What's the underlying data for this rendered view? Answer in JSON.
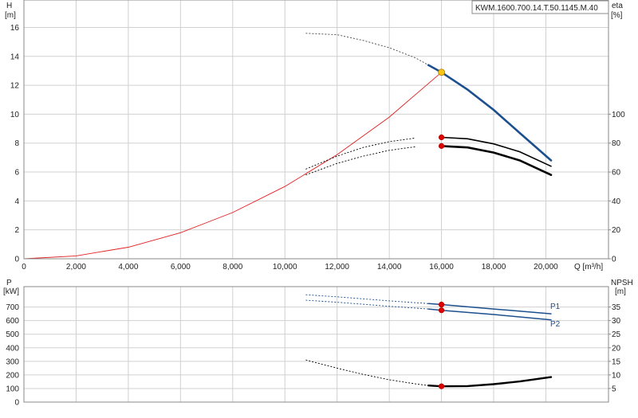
{
  "chart_data": [
    {
      "type": "line",
      "title": "KWM.1600.700.14.T.50.1145.M.40",
      "xlabel": "Q [m³/h]",
      "ylabel_left_name": "H",
      "ylabel_left_unit": "[m]",
      "ylabel_right_name": "eta",
      "ylabel_right_unit": "[%]",
      "x_ticks": [
        0,
        2000,
        4000,
        6000,
        8000,
        10000,
        12000,
        14000,
        16000,
        18000,
        20000
      ],
      "x_tick_labels": [
        "0",
        "2,000",
        "4,000",
        "6,000",
        "8,000",
        "10,000",
        "12,000",
        "14,000",
        "16,000",
        "18,000",
        "20,000"
      ],
      "xlim": [
        0,
        22400
      ],
      "y_left_ticks": [
        0,
        2,
        4,
        6,
        8,
        10,
        12,
        14,
        16
      ],
      "y_left_lim": [
        0,
        17.9
      ],
      "y_right_ticks": [
        0,
        20,
        40,
        60,
        80,
        100
      ],
      "y_right_lim": [
        0,
        179
      ],
      "grid": true,
      "duty_point": {
        "x": 16000,
        "y": 12.9
      },
      "series": [
        {
          "role": "pump-curve-H",
          "axis": "left",
          "color": "#1c4f8e",
          "x": [
            10800,
            12000,
            13000,
            14000,
            15000,
            15500,
            16000,
            17000,
            18000,
            19000,
            20200
          ],
          "y": [
            15.6,
            15.5,
            15.1,
            14.6,
            13.9,
            13.4,
            12.9,
            11.7,
            10.3,
            8.7,
            6.8
          ]
        },
        {
          "role": "system-curve",
          "axis": "left",
          "color": "#e02020",
          "x": [
            0,
            2000,
            4000,
            6000,
            8000,
            10000,
            12000,
            14000,
            16000
          ],
          "y": [
            0,
            0.2,
            0.8,
            1.8,
            3.2,
            5.0,
            7.2,
            9.8,
            12.9
          ]
        },
        {
          "role": "efficiency-1",
          "axis": "right",
          "color": "#000000",
          "x": [
            10800,
            12000,
            13000,
            14000,
            15000,
            16000,
            17000,
            18000,
            19000,
            20200
          ],
          "y": [
            62,
            71,
            77,
            81,
            83.5,
            84,
            83,
            79.5,
            74,
            64
          ]
        },
        {
          "role": "efficiency-2",
          "axis": "right",
          "color": "#000000",
          "x": [
            10800,
            12000,
            13000,
            14000,
            15000,
            16000,
            17000,
            18000,
            19000,
            20200
          ],
          "y": [
            58,
            66,
            71,
            75,
            77.5,
            78,
            77,
            73.5,
            68,
            58
          ]
        }
      ],
      "markers": [
        {
          "x": 16000,
          "y": 12.9,
          "axis": "left",
          "color": "#f5c518"
        },
        {
          "x": 16000,
          "y": 84,
          "axis": "right",
          "color": "#e00000"
        },
        {
          "x": 16000,
          "y": 78,
          "axis": "right",
          "color": "#e00000"
        }
      ]
    },
    {
      "type": "line",
      "ylabel_left_name": "P",
      "ylabel_left_unit": "[kW]",
      "ylabel_right_name": "NPSH",
      "ylabel_right_unit": "[m]",
      "x_ticks": [
        0,
        2000,
        4000,
        6000,
        8000,
        10000,
        12000,
        14000,
        16000,
        18000,
        20000
      ],
      "xlim": [
        0,
        22400
      ],
      "y_left_ticks": [
        0,
        100,
        200,
        300,
        400,
        500,
        600,
        700
      ],
      "y_left_lim": [
        0,
        850
      ],
      "y_right_ticks": [
        5,
        10,
        15,
        20,
        25,
        30,
        35
      ],
      "y_right_lim": [
        0,
        42.5
      ],
      "grid": true,
      "series": [
        {
          "name": "P1",
          "axis": "left",
          "color": "#1c4f8e",
          "x": [
            10800,
            12000,
            14000,
            15500,
            16000,
            18000,
            20200
          ],
          "y": [
            790,
            775,
            745,
            725,
            718,
            685,
            650
          ]
        },
        {
          "name": "P2",
          "axis": "left",
          "color": "#1c4f8e",
          "x": [
            10800,
            12000,
            14000,
            15500,
            16000,
            18000,
            20200
          ],
          "y": [
            750,
            735,
            705,
            685,
            676,
            645,
            605
          ]
        },
        {
          "role": "npsh",
          "axis": "right",
          "color": "#000000",
          "x": [
            10800,
            12000,
            13000,
            14000,
            15000,
            15500,
            16000,
            17000,
            18000,
            19000,
            20200
          ],
          "y": [
            15.5,
            12.5,
            10.2,
            8.2,
            6.7,
            6.1,
            5.8,
            5.9,
            6.6,
            7.6,
            9.2
          ]
        }
      ],
      "markers": [
        {
          "x": 16000,
          "y": 718,
          "axis": "left",
          "color": "#e00000"
        },
        {
          "x": 16000,
          "y": 676,
          "axis": "left",
          "color": "#e00000"
        },
        {
          "x": 16000,
          "y": 5.8,
          "axis": "right",
          "color": "#e00000"
        }
      ]
    }
  ]
}
